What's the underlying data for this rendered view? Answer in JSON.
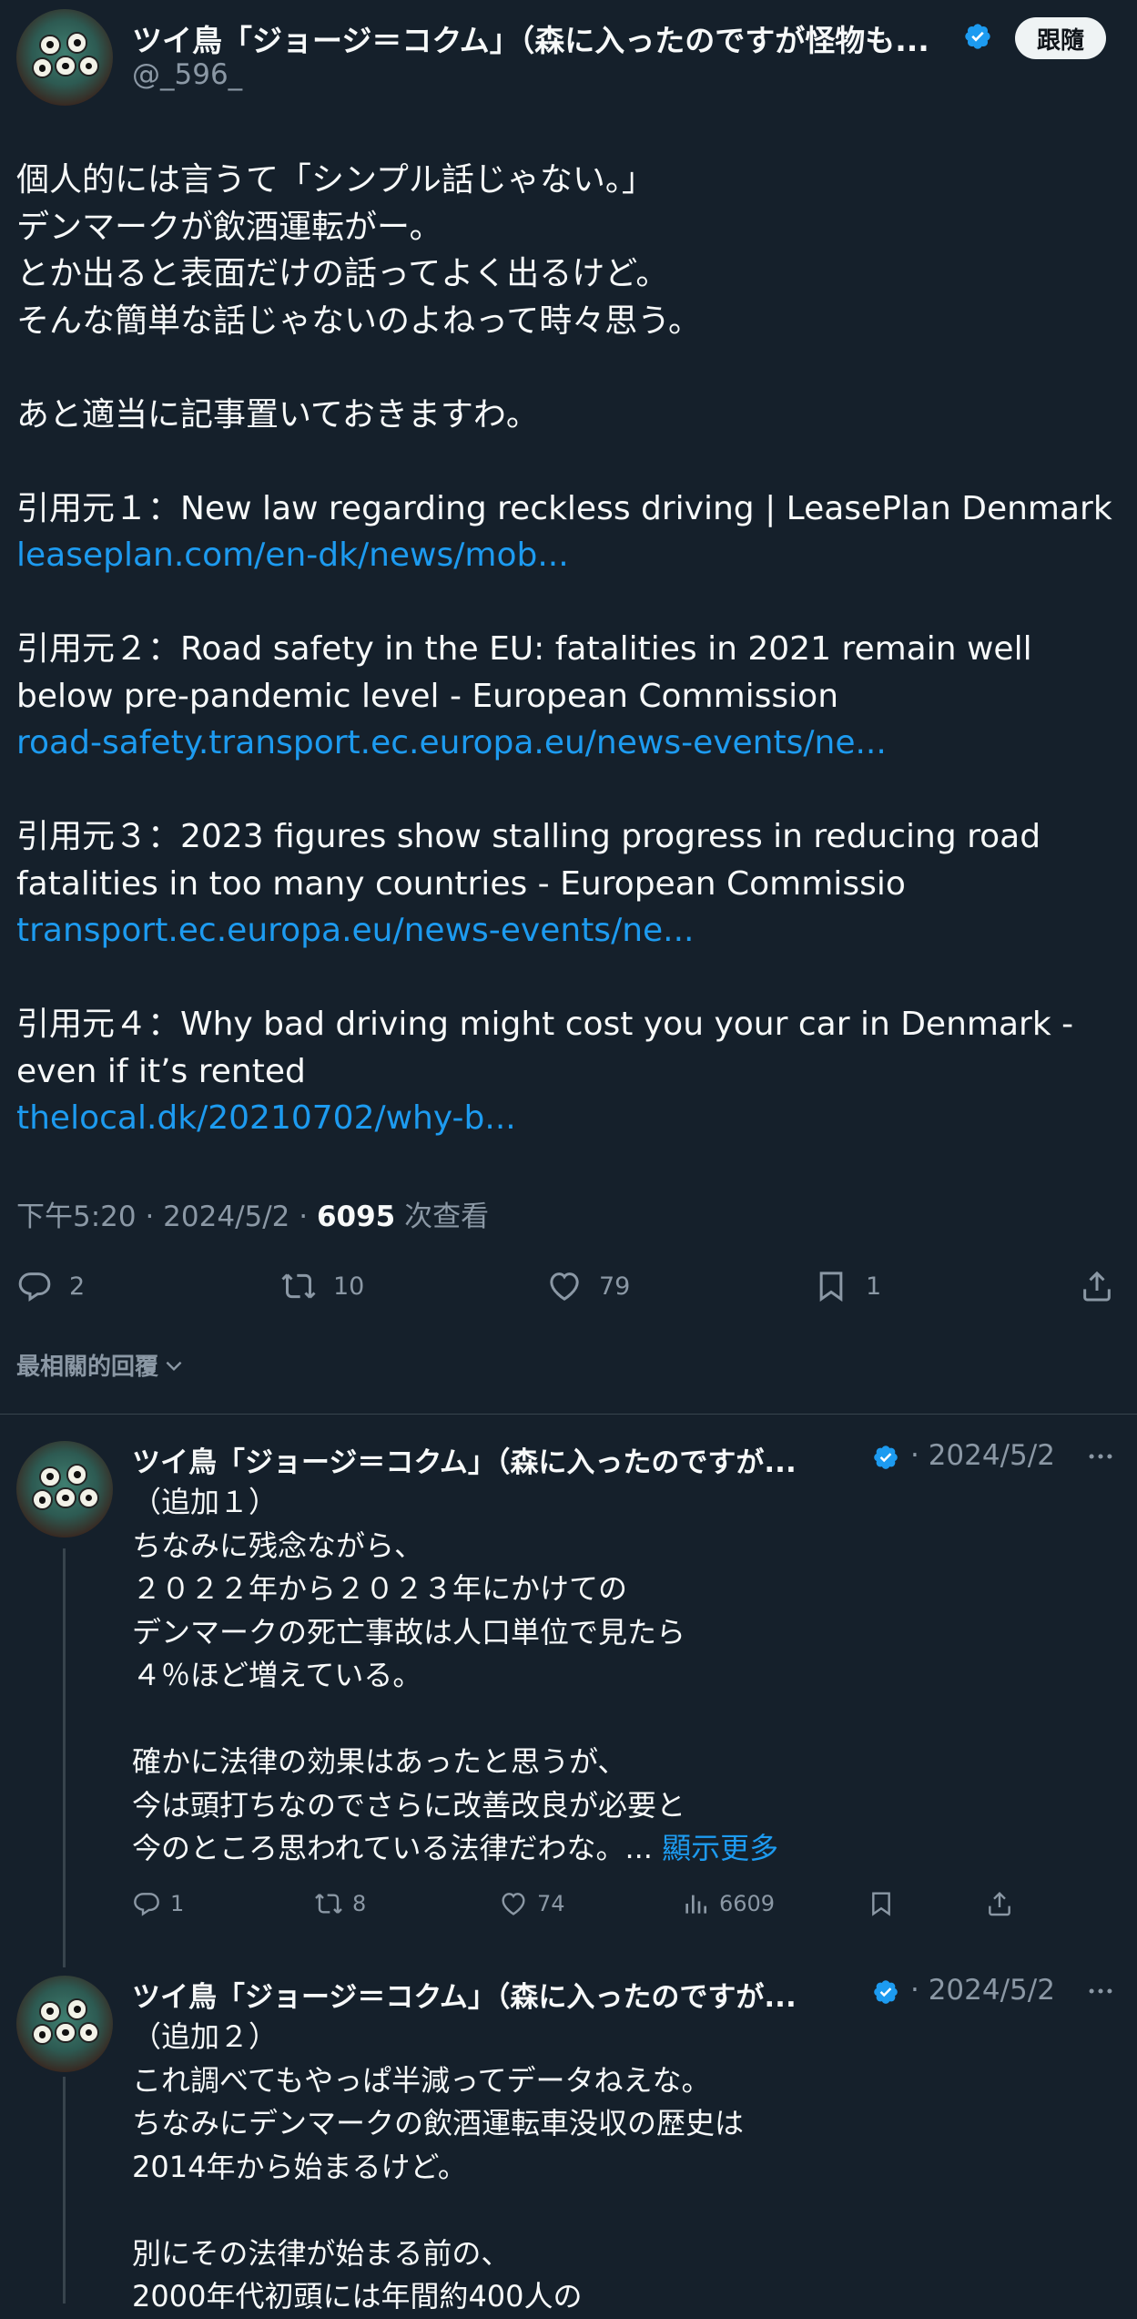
{
  "main_tweet": {
    "author_name": "ツイ鳥「ジョージ＝コクム」（森に入ったのですが怪物も...",
    "handle": "@_596_",
    "follow_label": "跟隨",
    "body_lines": [
      "個人的には言うて「シンプル話じゃない。」",
      "デンマークが飲酒運転がー。",
      "とか出ると表面だけの話ってよく出るけど。",
      "そんな簡単な話じゃないのよねって時々思う。",
      "あと適当に記事置いておきますわ。",
      "引用元１：New law regarding reckless driving | LeasePlan Denmark",
      "引用元２：Road safety in the EU: fatalities in 2021 remain well below pre-pandemic level - European Commission",
      "引用元３：2023 figures show stalling progress in reducing road fatalities in too many countries - European Commissio",
      "引用元４：Why bad driving might cost you your car in Denmark - even if it’s rented"
    ],
    "links": [
      "leaseplan.com/en-dk/news/mob...",
      "road-safety.transport.ec.europa.eu/news-events/ne...",
      "transport.ec.europa.eu/news-events/ne...",
      "thelocal.dk/20210702/why-b..."
    ],
    "meta": {
      "time_date": "下午5:20 · 2024/5/2 · ",
      "views": "6095",
      "views_label": " 次查看"
    },
    "actions": {
      "replies": "2",
      "retweets": "10",
      "likes": "79",
      "bookmarks": "1"
    }
  },
  "sort_label": "最相關的回覆",
  "replies": [
    {
      "author_name": "ツイ鳥「ジョージ＝コクム」（森に入ったのですが...",
      "date": "· 2024/5/2",
      "lines": [
        "（追加１）",
        "ちなみに残念ながら、",
        "２０２２年から２０２３年にかけての",
        "デンマークの死亡事故は人口単位で見たら",
        "４％ほど増えている。",
        "確かに法律の効果はあったと思うが、",
        "今は頭打ちなのでさらに改善改良が必要と",
        "今のところ思われている法律だわな。... "
      ],
      "show_more": "顯示更多",
      "actions": {
        "replies": "1",
        "retweets": "8",
        "likes": "74",
        "views": "6609"
      }
    },
    {
      "author_name": "ツイ鳥「ジョージ＝コクム」（森に入ったのですが...",
      "date": "· 2024/5/2",
      "lines": [
        "（追加２）",
        "これ調べてもやっぱ半減ってデータねえな。",
        "ちなみにデンマークの飲酒運転車没収の歴史は",
        "2014年から始まるけど。",
        "別にその法律が始まる前の、",
        "2000年代初頭には年間約400人の"
      ]
    }
  ],
  "colors": {
    "background": "#15202b",
    "text": "#f7f9f9",
    "secondary": "#8b98a5",
    "link": "#1d9bf0",
    "verified": "#1d9bf0",
    "divider": "#38444d"
  }
}
